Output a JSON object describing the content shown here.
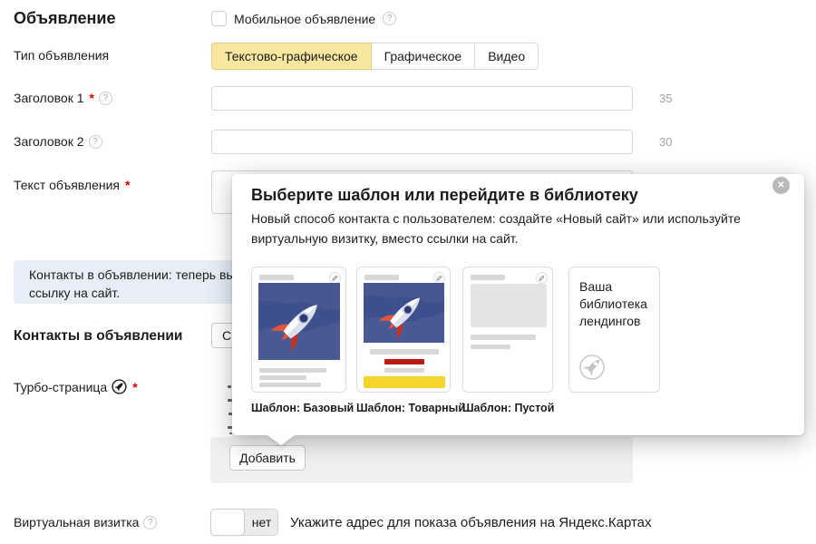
{
  "form": {
    "heading": "Объявление",
    "mobile_ad": {
      "label": "Мобильное объявление",
      "checked": false
    },
    "ad_type": {
      "label": "Тип объявления",
      "tabs": [
        {
          "label": "Текстово-графическое",
          "selected": true
        },
        {
          "label": "Графическое",
          "selected": false
        },
        {
          "label": "Видео",
          "selected": false
        }
      ]
    },
    "headline1": {
      "label": "Заголовок 1",
      "required": true,
      "value": "",
      "chars_left": "35"
    },
    "headline2": {
      "label": "Заголовок 2",
      "required": false,
      "value": "",
      "chars_left": "30"
    },
    "ad_text": {
      "label": "Текст объявления",
      "required": true,
      "value": ""
    },
    "info_banner": {
      "line1": "Контакты в объявлении: теперь вы мо",
      "line2": "ссылку на сайт."
    },
    "contacts": {
      "heading": "Контакты в объявлении",
      "button_visible_text": "С"
    },
    "turbo_page": {
      "label": "Турбо-страница",
      "required": true,
      "add_button": "Добавить"
    },
    "virtual_card": {
      "label": "Виртуальная визитка",
      "toggle_value": "нет",
      "hint": "Укажите адрес для показа объявления на Яндекс.Картах"
    }
  },
  "popup": {
    "title": "Выберите шаблон или перейдите в библиотеку",
    "description": "Новый способ контакта с пользователем: создайте «Новый сайт» или используйте виртуальную визитку, вместо ссылки на сайт.",
    "cards": [
      {
        "label": "Шаблон: Базовый"
      },
      {
        "label": "Шаблон: Товарный"
      },
      {
        "label": "Шаблон: Пустой"
      },
      {
        "label": "Ваша библиотека лендингов"
      }
    ]
  },
  "colors": {
    "selected_tab_bg": "#f8e79e",
    "selected_tab_border": "#e2cc80",
    "info_banner_bg": "#e6eef8",
    "card_image_blue": "#3e4f8d",
    "product_button_yellow": "#f5d42c",
    "product_bar_red": "#bb1b15",
    "required_asterisk": "#d40000",
    "turbo_panel_gray": "#f0f0ee"
  }
}
